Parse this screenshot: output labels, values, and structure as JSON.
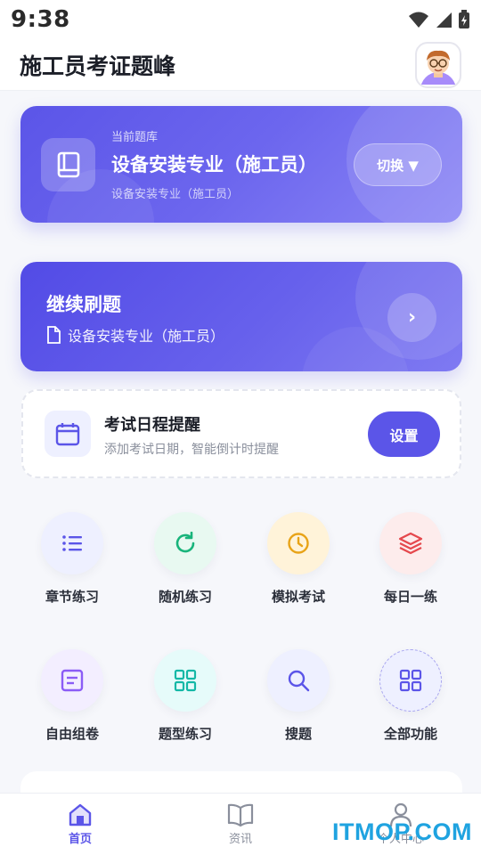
{
  "status_bar": {
    "time": "9:38"
  },
  "header": {
    "title": "施工员考证题峰",
    "avatar_icon": "user-avatar-icon"
  },
  "question_bank": {
    "caption": "当前题库",
    "name": "设备安装专业（施工员）",
    "subtitle": "设备安装专业（施工员）",
    "switch_label": "切换 ▼"
  },
  "continue": {
    "title": "继续刷题",
    "subtitle": "设备安装专业（施工员）",
    "arrow": "›"
  },
  "reminder": {
    "title": "考试日程提醒",
    "subtitle": "添加考试日期，智能倒计时提醒",
    "button": "设置"
  },
  "features": [
    {
      "label": "章节练习",
      "icon": "list-icon",
      "color": "#5b55e8"
    },
    {
      "label": "随机练习",
      "icon": "refresh-icon",
      "color": "#18b47b"
    },
    {
      "label": "模拟考试",
      "icon": "clock-icon",
      "color": "#e8a317"
    },
    {
      "label": "每日一练",
      "icon": "layers-icon",
      "color": "#e5484d"
    },
    {
      "label": "自由组卷",
      "icon": "document-icon",
      "color": "#8b5cf6"
    },
    {
      "label": "题型练习",
      "icon": "grid-icon",
      "color": "#14b8a6"
    },
    {
      "label": "搜题",
      "icon": "search-icon",
      "color": "#5b55e8"
    },
    {
      "label": "全部功能",
      "icon": "grid-icon",
      "color": "#5b55e8"
    }
  ],
  "tabs": [
    {
      "label": "首页",
      "icon": "home-icon",
      "active": true
    },
    {
      "label": "资讯",
      "icon": "book-icon",
      "active": false
    },
    {
      "label": "个人中心",
      "icon": "user-icon",
      "active": false
    }
  ],
  "watermark": "ITMOP.COM"
}
